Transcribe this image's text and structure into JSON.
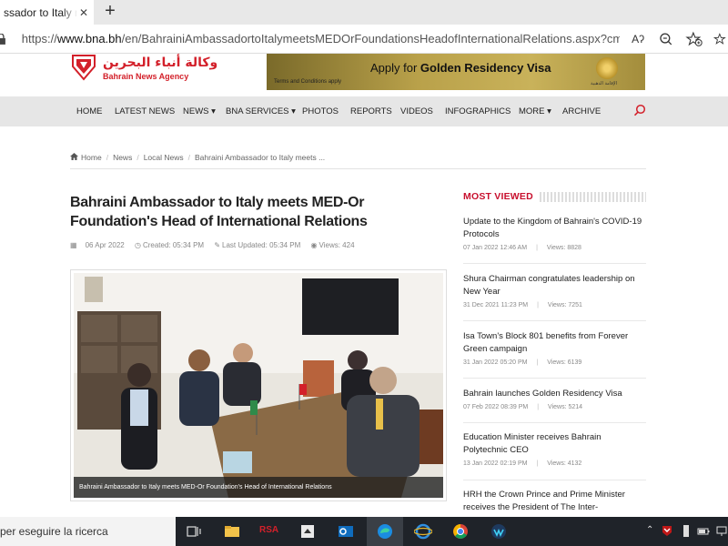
{
  "browser": {
    "tab_title": "ssador to Italy me",
    "tab_close": "✕",
    "new_tab": "+",
    "url_prefix": "https://",
    "url_domain": "www.bna.bh",
    "url_path": "/en/BahrainiAmbassadortoItalymeetsMEDOrFoundationsHeadofInternationalRelations.aspx?cms=q8FmFJ...",
    "read_aloud_icon": "Aʔ",
    "zoom_icon": "zoom-icon",
    "favorite_icon": "star-add-icon"
  },
  "site": {
    "logo_ar": "وكالة أنباء البحرين",
    "logo_en": "Bahrain News Agency",
    "brand_color": "#d3202a",
    "banner": {
      "title_prefix": "Apply for ",
      "title_bold": "Golden Residency Visa",
      "terms": "Terms and Conditions apply",
      "seal_text": "الإقامة الذهبية"
    }
  },
  "nav": {
    "items": [
      {
        "label": "HOME"
      },
      {
        "label": "LATEST NEWS"
      },
      {
        "label": "NEWS ▾"
      },
      {
        "label": "BNA SERVICES ▾"
      },
      {
        "label": "PHOTOS"
      },
      {
        "label": "REPORTS"
      },
      {
        "label": "VIDEOS"
      },
      {
        "label": "INFOGRAPHICS"
      },
      {
        "label": "MORE ▾"
      },
      {
        "label": "ARCHIVE"
      }
    ]
  },
  "breadcrumb": {
    "home": "Home",
    "news": "News",
    "local": "Local News",
    "current": "Bahraini Ambassador to Italy meets ..."
  },
  "article": {
    "title": "Bahraini Ambassador to Italy meets MED-Or Foundation's Head of International Relations",
    "date": "06 Apr 2022",
    "created": "Created: 05:34 PM",
    "updated": "Last Updated: 05:34 PM",
    "views": "Views: 424",
    "caption": "Bahraini Ambassador to Italy meets MED-Or Foundation's Head of International Relations"
  },
  "most_viewed": {
    "heading": "MOST VIEWED",
    "accent_color": "#c8102e",
    "items": [
      {
        "title": "Update to the Kingdom of Bahrain's COVID-19 Protocols",
        "date": "07 Jan 2022 12:46 AM",
        "views": "Views: 8828"
      },
      {
        "title": "Shura Chairman congratulates leadership on New Year",
        "date": "31 Dec 2021 11:23 PM",
        "views": "Views: 7251"
      },
      {
        "title": "Isa Town's Block 801 benefits from Forever Green campaign",
        "date": "31 Jan 2022 05:20 PM",
        "views": "Views: 6139"
      },
      {
        "title": "Bahrain launches Golden Residency Visa",
        "date": "07 Feb 2022 08:39 PM",
        "views": "Views: 5214"
      },
      {
        "title": "Education Minister receives Bahrain Polytechnic CEO",
        "date": "13 Jan 2022 02:19 PM",
        "views": "Views: 4132"
      },
      {
        "title": "HRH the Crown Prince and Prime Minister receives the President of The Inter-",
        "date": "",
        "views": ""
      }
    ]
  },
  "taskbar": {
    "search_text": "per eseguire la ricerca",
    "rsa_label": "RSA"
  }
}
